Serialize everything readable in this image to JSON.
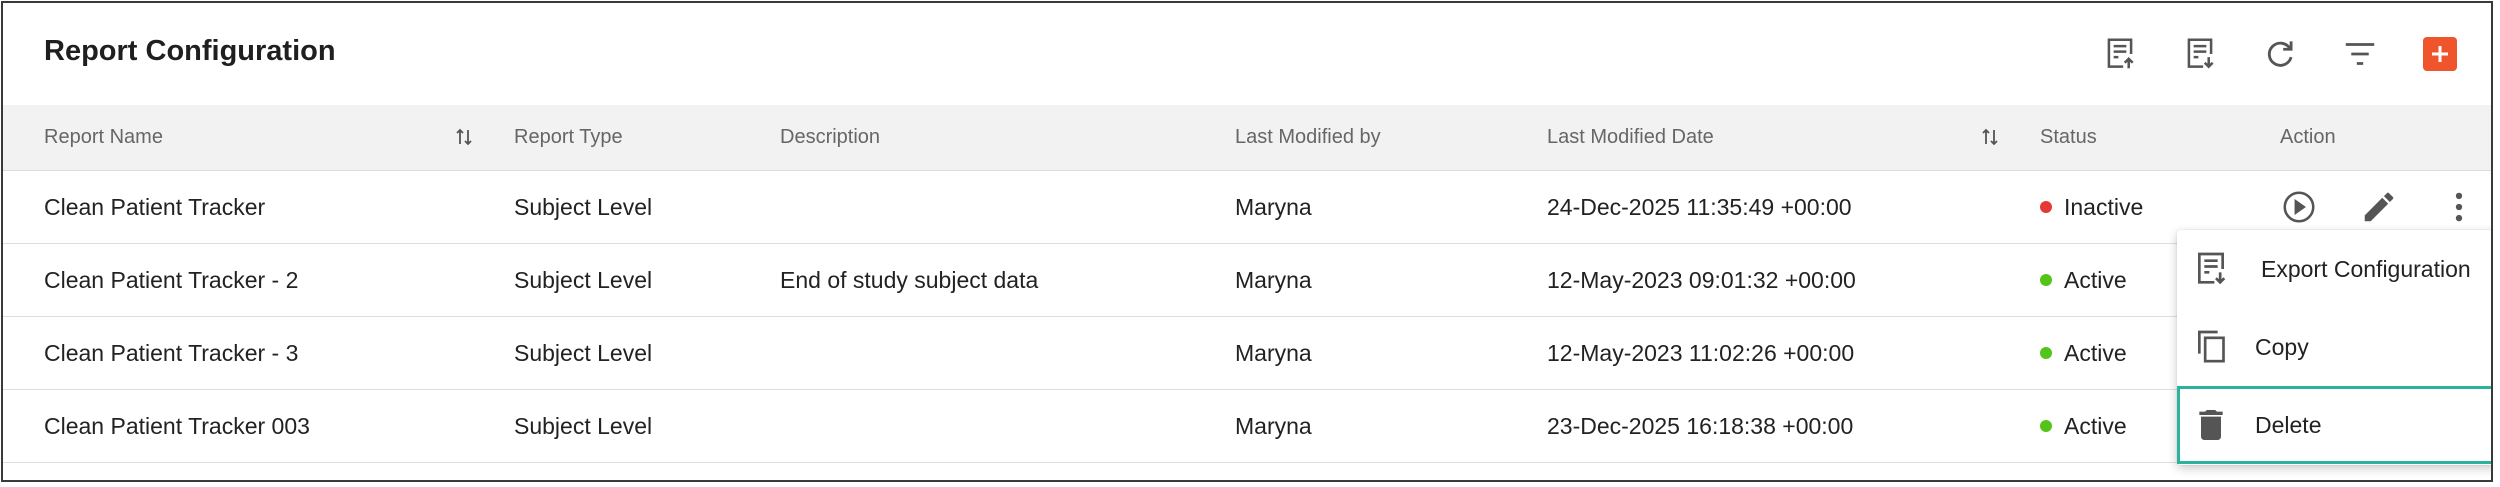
{
  "header": {
    "title": "Report Configuration"
  },
  "toolbar": {
    "icons": [
      "import-icon",
      "export-icon",
      "refresh-icon",
      "filter-icon",
      "add-icon"
    ],
    "accent_color": "#f0542d"
  },
  "table": {
    "columns": {
      "report_name": "Report Name",
      "report_type": "Report Type",
      "description": "Description",
      "last_modified_by": "Last Modified by",
      "last_modified_date": "Last Modified Date",
      "status": "Status",
      "action": "Action"
    },
    "rows": [
      {
        "name": "Clean Patient Tracker",
        "type": "Subject Level",
        "description": "",
        "modified_by": "Maryna",
        "modified_date": "24-Dec-2025 11:35:49 +00:00",
        "status": "Inactive",
        "status_color": "#e53935"
      },
      {
        "name": "Clean Patient Tracker - 2",
        "type": "Subject Level",
        "description": "End of study subject data",
        "modified_by": "Maryna",
        "modified_date": "12-May-2023 09:01:32 +00:00",
        "status": "Active",
        "status_color": "#52c41a"
      },
      {
        "name": "Clean Patient Tracker - 3",
        "type": "Subject Level",
        "description": "",
        "modified_by": "Maryna",
        "modified_date": "12-May-2023 11:02:26 +00:00",
        "status": "Active",
        "status_color": "#52c41a"
      },
      {
        "name": "Clean Patient Tracker 003",
        "type": "Subject Level",
        "description": "",
        "modified_by": "Maryna",
        "modified_date": "23-Dec-2025 16:18:38 +00:00",
        "status": "Active",
        "status_color": "#52c41a"
      }
    ]
  },
  "context_menu": {
    "items": [
      {
        "label": "Export Configuration",
        "icon": "export-icon"
      },
      {
        "label": "Copy",
        "icon": "copy-icon"
      },
      {
        "label": "Delete",
        "icon": "trash-icon",
        "highlighted": true
      }
    ],
    "highlight_color": "#2bb3a0"
  }
}
